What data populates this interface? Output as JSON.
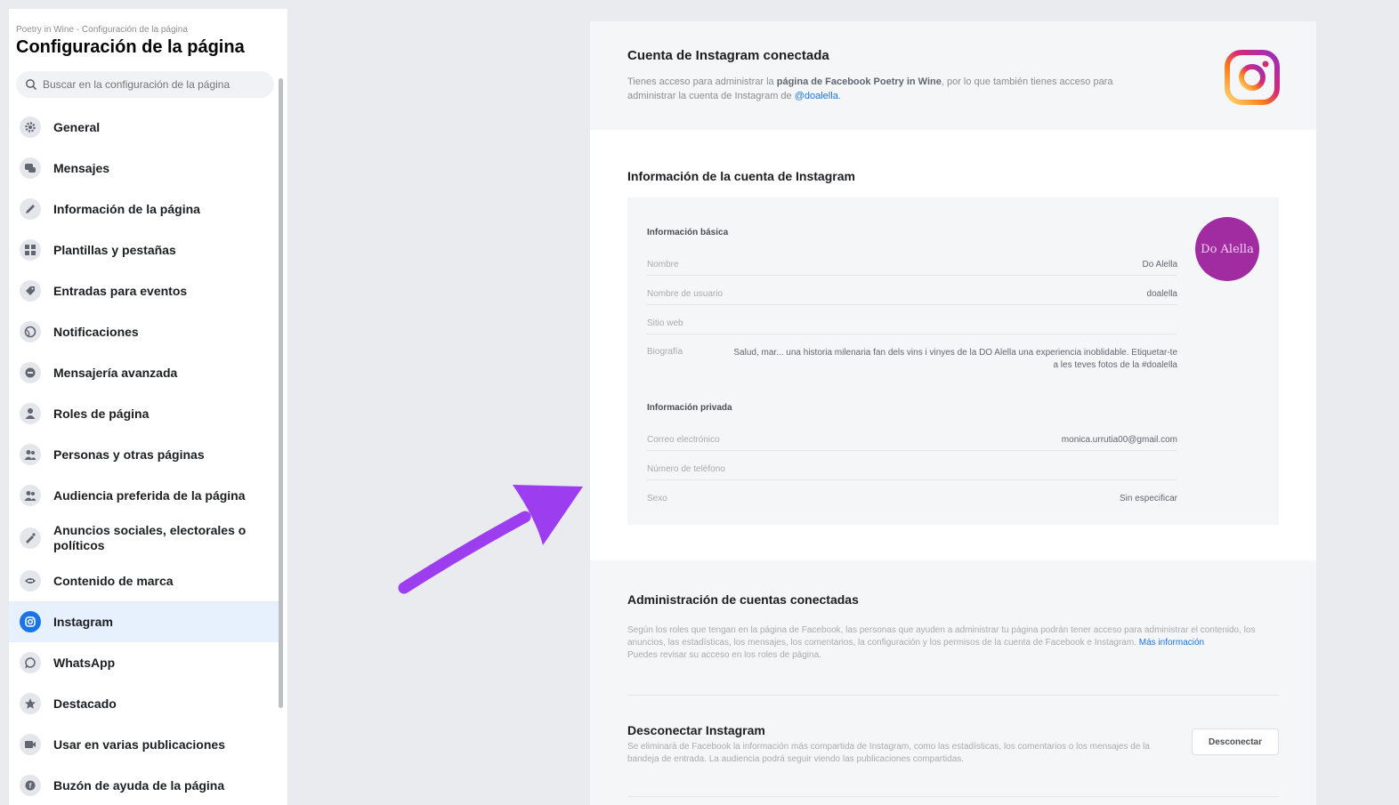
{
  "sidebar": {
    "breadcrumb": "Poetry in Wine - Configuración de la página",
    "title": "Configuración de la página",
    "search_placeholder": "Buscar en la configuración de la página",
    "items": [
      {
        "label": "General",
        "icon": "gear-icon"
      },
      {
        "label": "Mensajes",
        "icon": "chat-icon"
      },
      {
        "label": "Información de la página",
        "icon": "pencil-icon"
      },
      {
        "label": "Plantillas y pestañas",
        "icon": "grid-icon"
      },
      {
        "label": "Entradas para eventos",
        "icon": "ticket-icon"
      },
      {
        "label": "Notificaciones",
        "icon": "globe-icon"
      },
      {
        "label": "Mensajería avanzada",
        "icon": "message-icon"
      },
      {
        "label": "Roles de página",
        "icon": "person-icon"
      },
      {
        "label": "Personas y otras páginas",
        "icon": "people-icon"
      },
      {
        "label": "Audiencia preferida de la página",
        "icon": "audience-icon"
      },
      {
        "label": "Anuncios sociales, electorales o políticos",
        "icon": "megaphone-icon"
      },
      {
        "label": "Contenido de marca",
        "icon": "handshake-icon"
      },
      {
        "label": "Instagram",
        "icon": "instagram-icon"
      },
      {
        "label": "WhatsApp",
        "icon": "whatsapp-icon"
      },
      {
        "label": "Destacado",
        "icon": "star-icon"
      },
      {
        "label": "Usar en varias publicaciones",
        "icon": "video-icon"
      },
      {
        "label": "Buzón de ayuda de la página",
        "icon": "help-icon"
      }
    ]
  },
  "connected": {
    "heading": "Cuenta de Instagram conectada",
    "desc_a": "Tienes acceso para administrar la",
    "desc_page": "página de Facebook Poetry in Wine",
    "desc_b": ", por lo que también tienes acceso para administrar la cuenta de Instagram de",
    "desc_handle": "@doalella",
    "desc_end": "."
  },
  "account_info": {
    "heading": "Información de la cuenta de Instagram",
    "basic_heading": "Información básica",
    "name_label": "Nombre",
    "name_value": "Do Alella",
    "username_label": "Nombre de usuario",
    "username_value": "doalella",
    "website_label": "Sitio web",
    "bio_label": "Biografía",
    "bio_value": "Salud, mar... una historia milenaria fan dels vins i vinyes de la DO Alella una experiencia inoblidable. Etiquetar-te a les teves fotos de la #doalella",
    "private_heading": "Información privada",
    "email_label": "Correo electrónico",
    "email_value": "monica.urrutia00@gmail.com",
    "phone_label": "Número de teléfono",
    "gender_label": "Sexo",
    "gender_value": "Sin especificar",
    "avatar_text": "Do Alella"
  },
  "admin": {
    "heading": "Administración de cuentas conectadas",
    "text": "Según los roles que tengan en la página de Facebook, las personas que ayuden a administrar tu página podrán tener acceso para administrar el contenido, los anuncios, las estadísticas, los mensajes, los comentarios, la configuración y los permisos de la cuenta de Facebook e Instagram.",
    "link": "Más información",
    "text2": "Puedes revisar su acceso en los roles de página."
  },
  "disconnect": {
    "heading": "Desconectar Instagram",
    "text": "Se eliminará de Facebook la información más compartida de Instagram, como las estadísticas, los comentarios o los mensajes de la bandeja de entrada. La audiencia podrá seguir viendo las publicaciones compartidas.",
    "button": "Desconectar"
  },
  "colors": {
    "accent": "#1b74e4",
    "arrow": "#9d3df0",
    "avatar": "#a12ba0"
  }
}
